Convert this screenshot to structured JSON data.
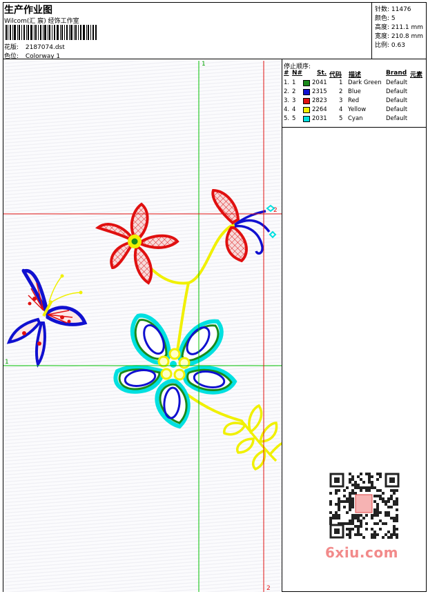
{
  "header": {
    "title": "生产作业图",
    "company": "Wilcom(汇 宸) 经饰工作室",
    "design_label": "花版:",
    "design_value": "2187074.dst",
    "colorway_label": "色位:",
    "colorway_value": "Colorway 1"
  },
  "stats": {
    "stitches": "针数: 11476",
    "colors": "颜色: 5",
    "height": "高度: 211.1 mm",
    "width": "宽度: 210.8 mm",
    "scale": "比例: 0.63"
  },
  "stop_sequence": {
    "title": "停止顺序:",
    "headers": {
      "num": "#",
      "no": "N#",
      "st": "St.",
      "code": "代码",
      "desc": "描述",
      "brand": "Brand",
      "element": "元素"
    },
    "rows": [
      {
        "num": "1.",
        "no": "1",
        "color": "#1a8a1a",
        "st": "2041",
        "code": "1",
        "desc": "Dark Green",
        "brand": "Default"
      },
      {
        "num": "2.",
        "no": "2",
        "color": "#1010d0",
        "st": "2315",
        "code": "2",
        "desc": "Blue",
        "brand": "Default"
      },
      {
        "num": "3.",
        "no": "3",
        "color": "#e01010",
        "st": "2823",
        "code": "3",
        "desc": "Red",
        "brand": "Default"
      },
      {
        "num": "4.",
        "no": "4",
        "color": "#f0f000",
        "st": "2264",
        "code": "4",
        "desc": "Yellow",
        "brand": "Default"
      },
      {
        "num": "5.",
        "no": "5",
        "color": "#00e0e0",
        "st": "2031",
        "code": "5",
        "desc": "Cyan",
        "brand": "Default"
      }
    ]
  },
  "guides": {
    "green_label": "1",
    "red_label": "2"
  },
  "watermark": "6xiu.com",
  "colors": {
    "green": "#1a8a1a",
    "blue": "#1010d0",
    "red": "#e01010",
    "yellow": "#f0f000",
    "cyan": "#00e0e0"
  }
}
